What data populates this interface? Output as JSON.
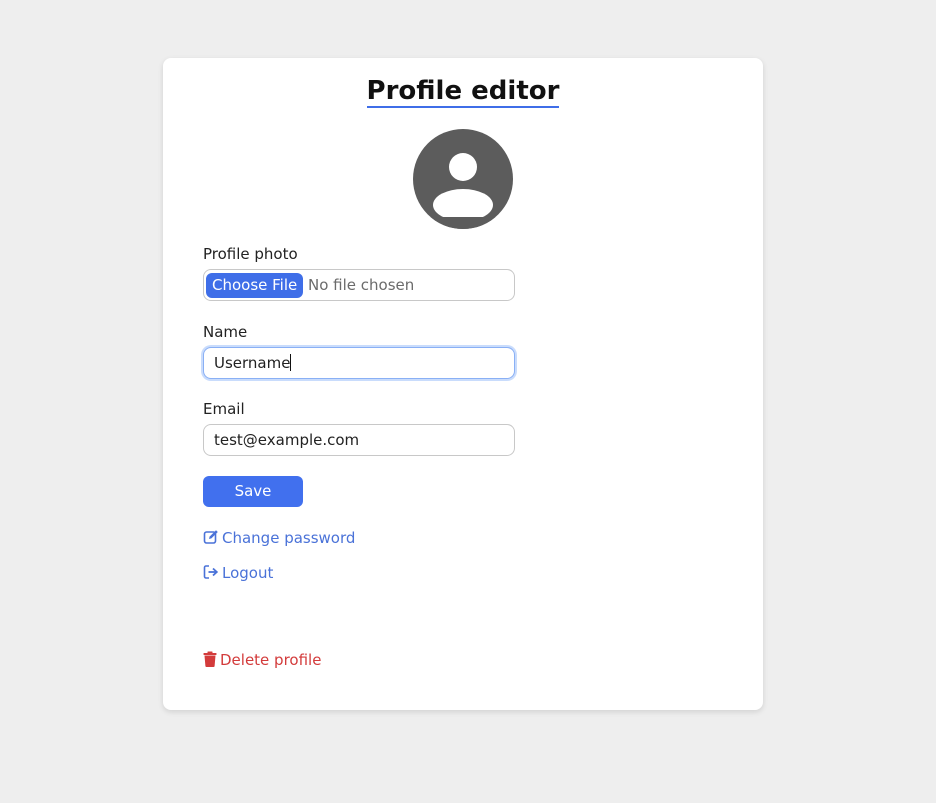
{
  "page": {
    "title": "Profile editor"
  },
  "avatar": {
    "icon": "user-avatar-icon"
  },
  "profile_photo": {
    "label": "Profile photo",
    "button_label": "Choose File",
    "status": "No file chosen"
  },
  "name": {
    "label": "Name",
    "value": "Username"
  },
  "email": {
    "label": "Email",
    "value": "test@example.com"
  },
  "actions": {
    "save_label": "Save",
    "change_password_label": "Change password",
    "change_password_icon": "edit-icon",
    "logout_label": "Logout",
    "logout_icon": "logout-icon",
    "delete_label": "Delete profile",
    "delete_icon": "trash-icon"
  },
  "colors": {
    "accent": "#4170ee",
    "link": "#4a72d8",
    "danger": "#d33b3b",
    "avatar_bg": "#5c5c5c",
    "page_bg": "#eeeeee"
  }
}
